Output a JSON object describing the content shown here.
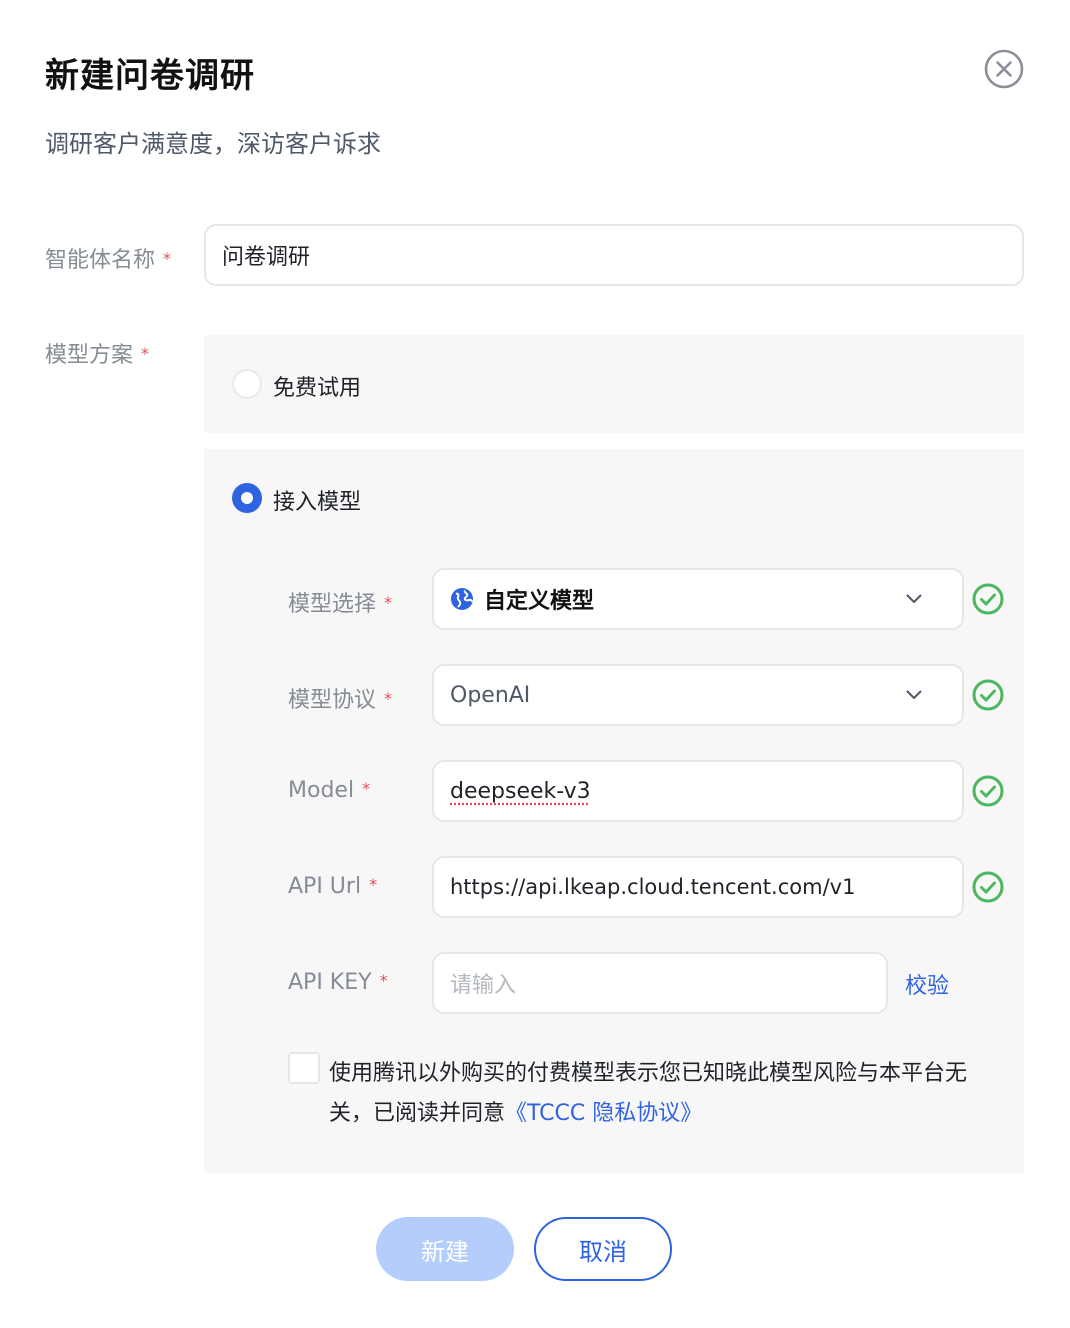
{
  "dialog": {
    "title": "新建问卷调研",
    "subtitle": "调研客户满意度，深访客户诉求",
    "close_icon": "close-circle-icon"
  },
  "form": {
    "name_label": "智能体名称",
    "name_value": "问卷调研",
    "plan_label": "模型方案",
    "required_mark": "*",
    "plans": {
      "free": {
        "label": "免费试用",
        "selected": false
      },
      "custom": {
        "label": "接入模型",
        "selected": true
      }
    },
    "custom_fields": {
      "model_select_label": "模型选择",
      "model_select_value": "自定义模型",
      "model_select_icon": "globe-icon",
      "protocol_label": "模型协议",
      "protocol_value": "OpenAI",
      "model_label": "Model",
      "model_value": "deepseek-v3",
      "api_url_label": "API Url",
      "api_url_value": "https://api.lkeap.cloud.tencent.com/v1",
      "api_key_label": "API KEY",
      "api_key_placeholder": "请输入",
      "verify_label": "校验"
    },
    "agreement": {
      "checked": false,
      "text": "使用腾讯以外购买的付费模型表示您已知晓此模型风险与本平台无关，已阅读并同意",
      "link": "《TCCC 隐私协议》"
    }
  },
  "buttons": {
    "create": "新建",
    "cancel": "取消"
  },
  "colors": {
    "primary": "#2f63e0",
    "success": "#4cb75c",
    "required": "#e34d59",
    "disabled_primary": "#b5cdfb"
  }
}
